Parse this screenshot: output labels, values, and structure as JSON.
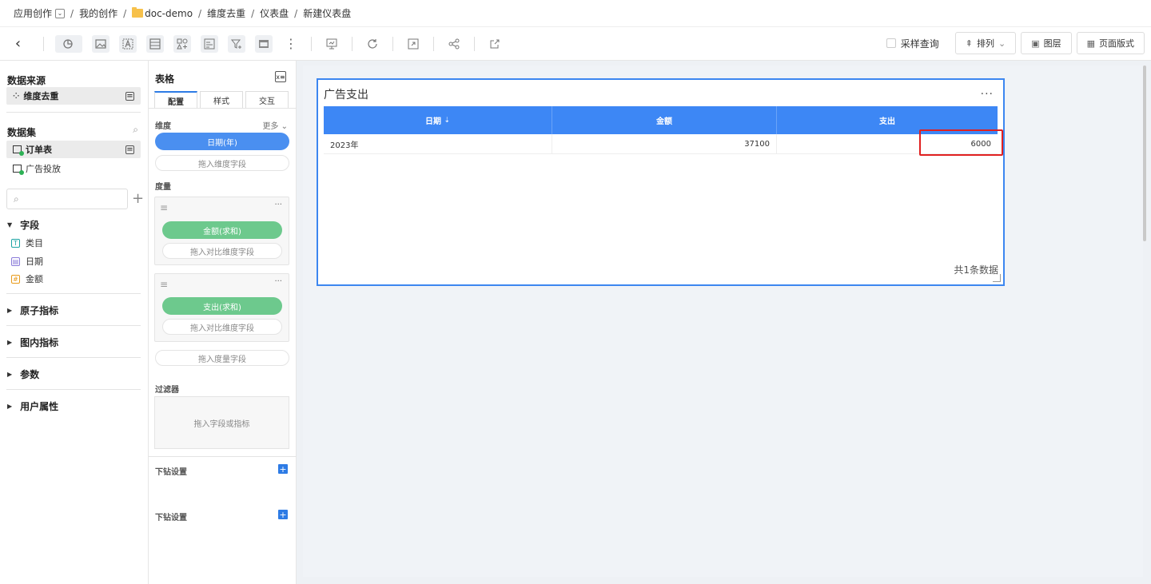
{
  "breadcrumb": {
    "root": "应用创作",
    "items": [
      "我的创作",
      "doc-demo",
      "维度去重",
      "仪表盘",
      "新建仪表盘"
    ]
  },
  "toolbar": {
    "sample_query": "采样查询",
    "arrange": "排列",
    "layers": "图层",
    "page_layout": "页面版式"
  },
  "left": {
    "datasource_title": "数据来源",
    "datasource_item": "维度去重",
    "dataset_title": "数据集",
    "datasets": [
      "订单表",
      "广告投放"
    ],
    "fields_title": "字段",
    "fields": [
      {
        "name": "类目",
        "type": "T",
        "color": "#1aa3a3"
      },
      {
        "name": "日期",
        "type": "date",
        "color": "#8a7bd9"
      },
      {
        "name": "金额",
        "type": "#",
        "color": "#e89a1a"
      }
    ],
    "groups": [
      "原子指标",
      "图内指标",
      "参数",
      "用户属性"
    ]
  },
  "mid": {
    "title": "表格",
    "tabs": [
      "配置",
      "样式",
      "交互"
    ],
    "dimension_label": "维度",
    "more": "更多",
    "dimension_pill": "日期(年)",
    "dimension_drop": "拖入维度字段",
    "measure_label": "度量",
    "measure1": "金额(求和)",
    "measure2": "支出(求和)",
    "compare_drop": "拖入对比维度字段",
    "measure_drop": "拖入度量字段",
    "filter_label": "过滤器",
    "filter_drop": "拖入字段或指标",
    "drill1": "下钻设置",
    "drill2": "下钻设置"
  },
  "card": {
    "title": "广告支出",
    "columns": [
      "日期",
      "金额",
      "支出"
    ],
    "rows": [
      [
        "2023年",
        "37100",
        "6000"
      ]
    ],
    "footer": "共1条数据"
  },
  "colors": {
    "header_blue": "#3d87f5",
    "pill_green": "#6dc98d",
    "highlight_red": "#e02020"
  }
}
